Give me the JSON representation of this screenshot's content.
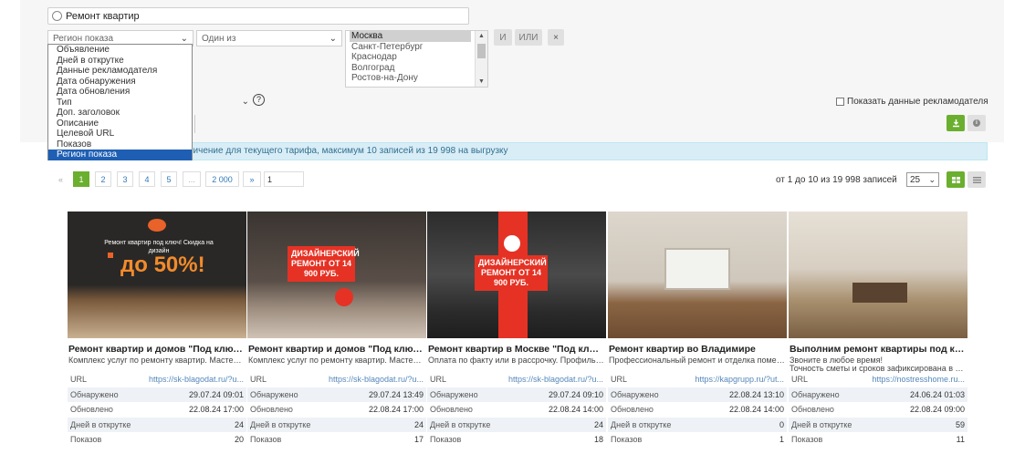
{
  "search": {
    "value": "Ремонт квартир"
  },
  "filters": {
    "field_select": "Регион показа",
    "op_select": "Один из",
    "field_options": [
      "Объявление",
      "Дней в открутке",
      "Данные рекламодателя",
      "Дата обнаружения",
      "Дата обновления",
      "Тип",
      "Доп. заголовок",
      "Описание",
      "Целевой URL",
      "Показов",
      "Регион показа"
    ],
    "region_options": [
      "Москва",
      "Санкт-Петербург",
      "Краснодар",
      "Волгоград",
      "Ростов-на-Дону"
    ],
    "and_label": "И",
    "or_label": "ИЛИ",
    "remove_label": "×",
    "help_label": "?",
    "show_advertiser_label": "Показать данные рекламодателя"
  },
  "info_text": "ничение для текущего тарифа, максимум 10 записей из 19 998 на выгрузку",
  "pagination": {
    "prev": "«",
    "pages": [
      "1",
      "2",
      "3",
      "4",
      "5",
      "...",
      "2 000"
    ],
    "next": "»",
    "goto_value": "1",
    "summary": "от 1 до 10 из 19 998 записей",
    "page_size": "25"
  },
  "labels": {
    "url": "URL",
    "found": "Обнаружено",
    "updated": "Обновлено",
    "days": "Дней в открутке",
    "shows": "Показов"
  },
  "cards": [
    {
      "title": "Ремонт квартир и домов \"Под ключ\"...",
      "desc": "Комплекс услуг по ремонту квартир. Мастера...",
      "url": "https://sk-blagodat.ru/?u...",
      "found": "29.07.24 09:01",
      "updated": "22.08.24 17:00",
      "days": "24",
      "shows": "20",
      "badge": "до 50%!",
      "img_text": "Ремонт квартир под ключ! Скидка на дизайн"
    },
    {
      "title": "Ремонт квартир и домов \"Под ключ\"...",
      "desc": "Комплекс услуг по ремонту квартир. Мастера...",
      "url": "https://sk-blagodat.ru/?u...",
      "found": "29.07.24 13:49",
      "updated": "22.08.24 17:00",
      "days": "24",
      "shows": "17",
      "badge": "ДИЗАЙНЕРСКИЙ РЕМОНТ ОТ 14 900 РУБ."
    },
    {
      "title": "Ремонт квартир в Москве \"Под ключ...",
      "desc": "Оплата по факту или в рассрочку. Профильн...",
      "url": "https://sk-blagodat.ru/?u...",
      "found": "29.07.24 09:10",
      "updated": "22.08.24 14:00",
      "days": "24",
      "shows": "18",
      "badge": "ДИЗАЙНЕРСКИЙ РЕМОНТ ОТ 14 900 РУБ."
    },
    {
      "title": "Ремонт квартир во Владимире",
      "desc": "Профессиональный ремонт и отделка помещ...",
      "url": "https://kapgrupp.ru/?ut...",
      "found": "22.08.24 13:10",
      "updated": "22.08.24 14:00",
      "days": "0",
      "shows": "1"
    },
    {
      "title": "Выполним ремонт квартиры под кл...",
      "desc": "Звоните в любое время!",
      "desc2": "Точность сметы и сроков зафиксирована в д...",
      "url": "https://nostresshome.ru...",
      "found": "24.06.24 01:03",
      "updated": "22.08.24 09:00",
      "days": "59",
      "shows": "11"
    }
  ]
}
